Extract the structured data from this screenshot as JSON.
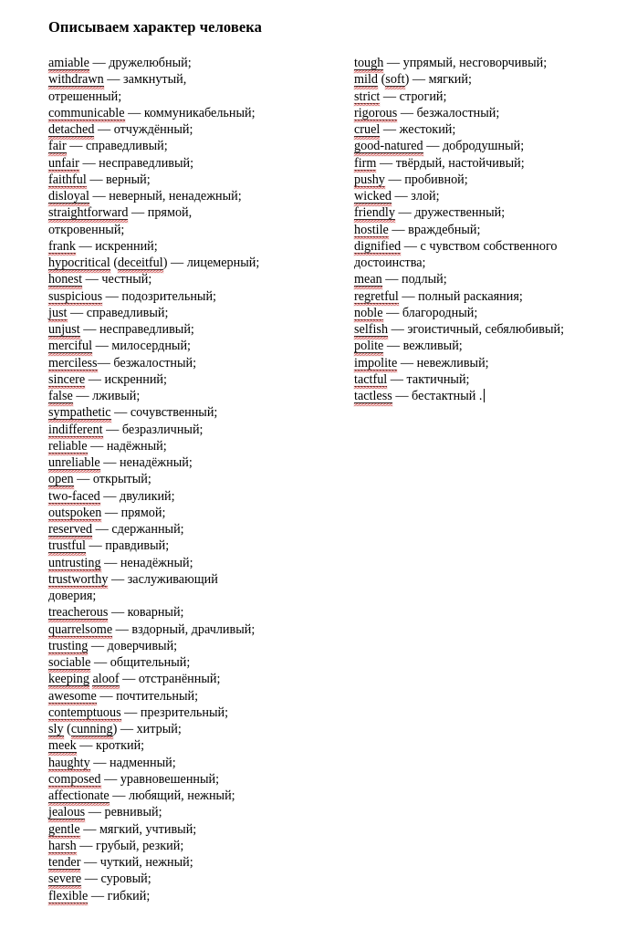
{
  "document": {
    "title": "Описываем характер человека",
    "background_color": "#ffffff",
    "text_color": "#000000",
    "spellcheck_underline_color": "#d4605f",
    "dash": " — ",
    "caret_visible": true
  },
  "columns": {
    "left": [
      {
        "en": "amiable",
        "ru": "дружелюбный;"
      },
      {
        "en": "withdrawn",
        "ru": "замкнутый,"
      },
      {
        "cont": "отрешенный;"
      },
      {
        "en": "communicable",
        "ru": "коммуникабельный;"
      },
      {
        "en": "detached",
        "ru": "отчуждённый;"
      },
      {
        "en": "fair",
        "ru": "справедливый;"
      },
      {
        "en": "unfair",
        "ru": "несправедливый;"
      },
      {
        "en": "faithful",
        "ru": "верный;"
      },
      {
        "en": "disloyal",
        "ru": "неверный, ненадежный;"
      },
      {
        "en": "straightforward",
        "ru": "прямой,"
      },
      {
        "cont": "откровенный;"
      },
      {
        "en": "frank",
        "ru": "искренний;"
      },
      {
        "en": "hypocritical",
        "en2": "deceitful",
        "ru": "лицемерный;"
      },
      {
        "en": "honest",
        "ru": "честный;"
      },
      {
        "en": "suspicious",
        "ru": "подозрительный;"
      },
      {
        "en": "just",
        "ru": "справедливый;"
      },
      {
        "en": "unjust",
        "ru": "несправедливый;"
      },
      {
        "en": "merciful",
        "ru": "милосердный;"
      },
      {
        "en": "merciless",
        "ru": "безжалостный;",
        "nospace": true
      },
      {
        "en": "sincere",
        "ru": "искренний;"
      },
      {
        "en": "false",
        "ru": "лживый;"
      },
      {
        "en": "sympathetic",
        "ru": "сочувственный;"
      },
      {
        "en": "indifferent",
        "ru": "безразличный;"
      },
      {
        "en": "reliable",
        "ru": "надёжный;"
      },
      {
        "en": "unreliable",
        "ru": "ненадёжный;"
      },
      {
        "en": "open",
        "ru": "открытый;"
      },
      {
        "en": "two-faced",
        "ru": "двуликий;"
      },
      {
        "en": "outspoken",
        "ru": "прямой;"
      },
      {
        "en": "reserved",
        "ru": "сдержанный;"
      },
      {
        "en": "trustful",
        "ru": "правдивый;"
      },
      {
        "en": "untrusting",
        "ru": "ненадёжный;"
      },
      {
        "en": "trustworthy",
        "ru": "заслуживающий"
      },
      {
        "cont": "доверия;"
      },
      {
        "en": "treacherous",
        "ru": "коварный;"
      },
      {
        "en": "quarrelsome",
        "ru": "вздорный, драчливый;"
      },
      {
        "en": "trusting",
        "ru": "доверчивый;"
      },
      {
        "en": "sociable",
        "ru": "общительный;"
      },
      {
        "en": "keeping",
        "en2_plain": "aloof",
        "ru": "отстранённый;"
      },
      {
        "en": "awesome",
        "ru": "почтительный;"
      },
      {
        "en": "contemptuous",
        "ru": "презрительный;"
      },
      {
        "en": "sly",
        "en2": "cunning",
        "ru": "хитрый;"
      },
      {
        "en": "meek",
        "ru": "кроткий;"
      },
      {
        "en": "haughty",
        "ru": "надменный;"
      },
      {
        "en": "composed",
        "ru": "уравновешенный;"
      },
      {
        "en": "affectionate",
        "ru": "любящий, нежный;"
      },
      {
        "en": "jealous",
        "ru": "ревнивый;"
      },
      {
        "en": "gentle",
        "ru": "мягкий, учтивый;"
      },
      {
        "en": "harsh",
        "ru": "грубый, резкий;"
      },
      {
        "en": "tender",
        "ru": "чуткий, нежный;"
      },
      {
        "en": "severe",
        "ru": "суровый;"
      },
      {
        "en": "flexible",
        "ru": "гибкий;"
      }
    ],
    "right": [
      {
        "en": "tough",
        "ru": "упрямый, несговорчивый;"
      },
      {
        "en": "mild",
        "en2": "soft",
        "ru": "мягкий;"
      },
      {
        "en": "strict",
        "ru": "строгий;"
      },
      {
        "en": "rigorous",
        "ru": "безжалостный;"
      },
      {
        "en": "cruel",
        "ru": "жестокий;"
      },
      {
        "en": "good-natured",
        "ru": "добродушный;"
      },
      {
        "en": "firm",
        "ru": "твёрдый, настойчивый;"
      },
      {
        "en": "pushy",
        "ru": "пробивной;"
      },
      {
        "en": "wicked",
        "ru": "злой;"
      },
      {
        "en": "friendly",
        "ru": "дружественный;"
      },
      {
        "en": "hostile",
        "ru": "враждебный;"
      },
      {
        "en": "dignified",
        "ru": "с чувством собственного"
      },
      {
        "cont": "достоинства;"
      },
      {
        "en": "mean",
        "ru": "подлый;"
      },
      {
        "en": "regretful",
        "ru": "полный раскаяния;"
      },
      {
        "en": "noble",
        "ru": "благородный;"
      },
      {
        "en": "selfish",
        "ru": "эгоистичный, себялюбивый;"
      },
      {
        "en": "polite",
        "ru": "вежливый;"
      },
      {
        "en": "impolite",
        "ru": "невежливый;"
      },
      {
        "en": "tactful",
        "ru": "тактичный;"
      },
      {
        "en": "tactless",
        "ru": "бестактный .",
        "caret": true
      }
    ]
  }
}
